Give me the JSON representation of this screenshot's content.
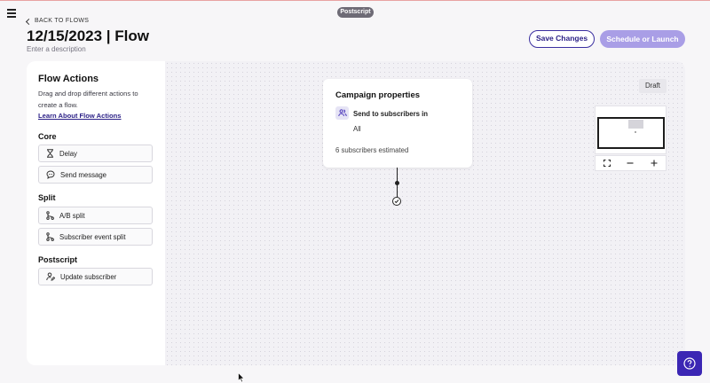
{
  "header": {
    "brand_chip": "Postscript",
    "back_label": "BACK TO FLOWS",
    "title": "12/15/2023 | Flow",
    "description_placeholder": "Enter a description",
    "save_label": "Save Changes",
    "launch_label": "Schedule or Launch"
  },
  "sidebar": {
    "title": "Flow Actions",
    "description": "Drag and drop different actions to create a flow.",
    "learn_link": "Learn About Flow Actions",
    "sections": [
      {
        "name": "Core",
        "items": [
          {
            "label": "Delay",
            "icon": "hourglass-icon"
          },
          {
            "label": "Send message",
            "icon": "chat-bubble-icon"
          }
        ]
      },
      {
        "name": "Split",
        "items": [
          {
            "label": "A/B split",
            "icon": "branch-icon"
          },
          {
            "label": "Subscriber event split",
            "icon": "branch-icon"
          }
        ]
      },
      {
        "name": "Postscript",
        "items": [
          {
            "label": "Update subscriber",
            "icon": "user-edit-icon"
          }
        ]
      }
    ]
  },
  "canvas": {
    "status_badge": "Draft",
    "campaign_card": {
      "title": "Campaign properties",
      "send_label": "Send to subscribers in",
      "segment": "All",
      "estimate": "6 subscribers estimated"
    },
    "minimap_controls": [
      "fit-view-icon",
      "zoom-out-icon",
      "zoom-in-icon"
    ]
  },
  "colors": {
    "primary": "#3b26b4",
    "primary_light": "#a99ee6",
    "link": "#2a1f86"
  }
}
